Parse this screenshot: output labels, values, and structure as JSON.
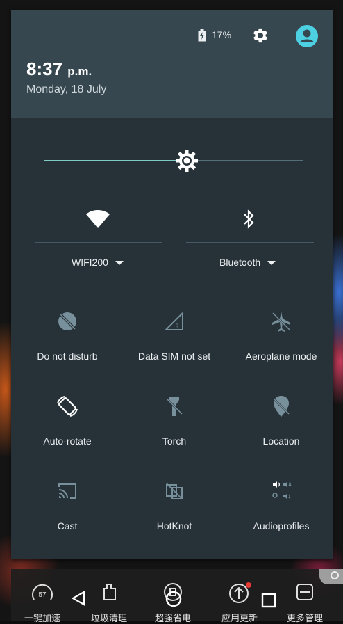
{
  "status": {
    "battery_percent": "17%",
    "icons": [
      "battery-charging-icon",
      "gear-icon",
      "user-account-icon"
    ]
  },
  "header": {
    "time": "8:37",
    "ampm": "p.m.",
    "date": "Monday, 18 July"
  },
  "brightness": {
    "level": 0.55
  },
  "connections": {
    "wifi": {
      "label": "WIFI200",
      "icon": "wifi-icon"
    },
    "bluetooth": {
      "label": "Bluetooth",
      "icon": "bluetooth-icon"
    }
  },
  "tiles": [
    {
      "label": "Do not disturb",
      "icon": "do-not-disturb-icon"
    },
    {
      "label": "Data SIM not set",
      "icon": "signal-icon"
    },
    {
      "label": "Aeroplane mode",
      "icon": "airplane-icon"
    },
    {
      "label": "Auto-rotate",
      "icon": "rotate-icon"
    },
    {
      "label": "Torch",
      "icon": "torch-icon"
    },
    {
      "label": "Location",
      "icon": "location-off-icon"
    },
    {
      "label": "Cast",
      "icon": "cast-icon"
    },
    {
      "label": "HotKnot",
      "icon": "hotknot-icon"
    },
    {
      "label": "Audioprofiles",
      "icon": "audio-profiles-icon"
    }
  ],
  "bottom_bar": {
    "items": [
      {
        "label": "一键加速",
        "badge": "57"
      },
      {
        "label": "垃圾清理"
      },
      {
        "label": "超强省电"
      },
      {
        "label": "应用更新"
      },
      {
        "label": "更多管理"
      }
    ]
  },
  "colors": {
    "panel": "#263238",
    "header": "#37474f",
    "accent": "#80cbc4",
    "user_icon": "#4dd0e1"
  }
}
